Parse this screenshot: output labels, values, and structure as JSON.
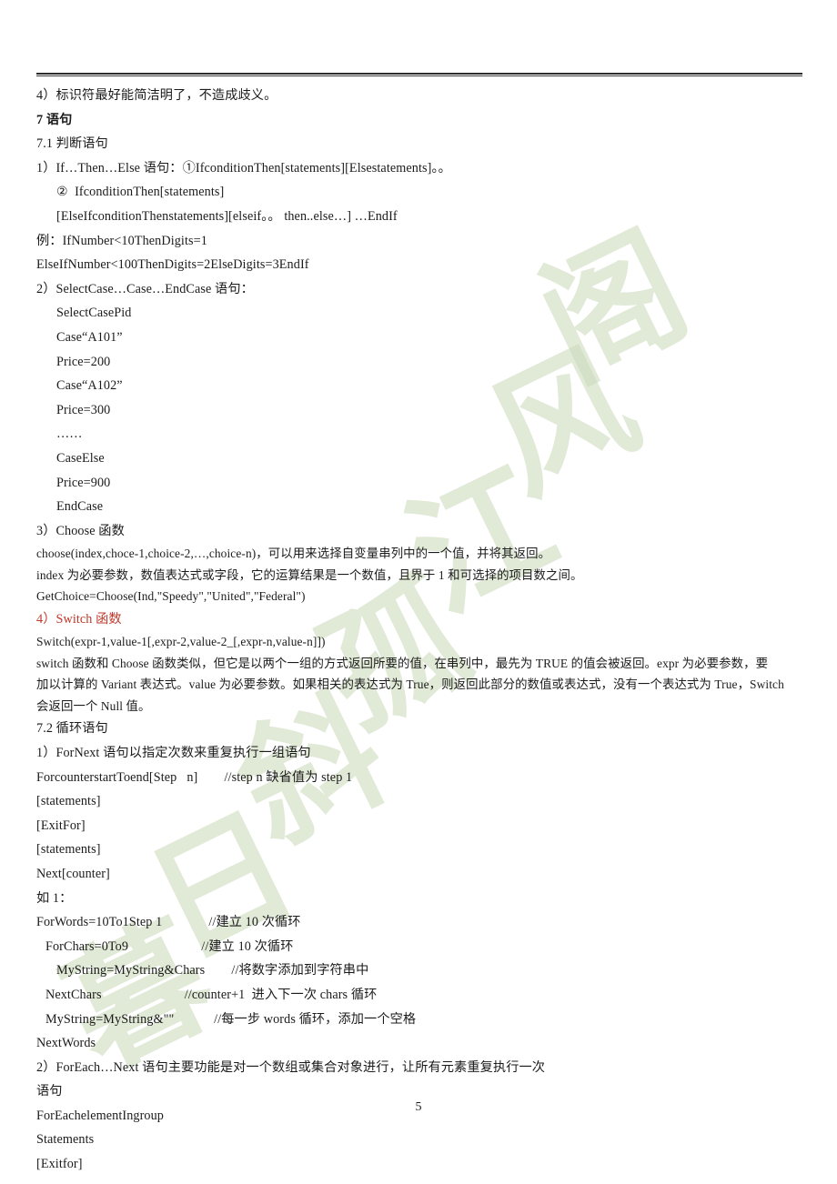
{
  "document": {
    "page_number": "5",
    "watermark_chars": [
      "阁",
      "风",
      "江",
      "孤",
      "斜",
      "日",
      "暮"
    ],
    "watermark_color": "#cfdcc0",
    "accent_red": "#c03a2b"
  },
  "body_lines": [
    {
      "text": "4）标识符最好能简洁明了，不造成歧义。",
      "indent": 0
    },
    {
      "text": "7 语句",
      "indent": 0,
      "bold": true
    },
    {
      "text": "7.1 判断语句",
      "indent": 0
    },
    {
      "text": "1）If…Then…Else 语句：①IfconditionThen[statements][Elsestatements]。。",
      "indent": 0
    },
    {
      "text": "②  IfconditionThen[statements]",
      "indent": 2
    },
    {
      "text": "[ElseIfconditionThenstatements][elseif。。 then..else…] …EndIf",
      "indent": 2
    },
    {
      "text": "例：IfNumber<10ThenDigits=1",
      "indent": 0
    },
    {
      "text": "ElseIfNumber<100ThenDigits=2ElseDigits=3EndIf",
      "indent": 0
    },
    {
      "text": "2）SelectCase…Case…EndCase 语句：",
      "indent": 0
    },
    {
      "text": "SelectCasePid",
      "indent": 2
    },
    {
      "text": "Case“A101”",
      "indent": 2
    },
    {
      "text": "Price=200",
      "indent": 2
    },
    {
      "text": "Case“A102”",
      "indent": 2
    },
    {
      "text": "Price=300",
      "indent": 2
    },
    {
      "text": "……",
      "indent": 2
    },
    {
      "text": "CaseElse",
      "indent": 2
    },
    {
      "text": "Price=900",
      "indent": 2
    },
    {
      "text": "EndCase",
      "indent": 2
    },
    {
      "text": "3）Choose 函数",
      "indent": 0
    },
    {
      "text": "choose(index,choce-1,choice-2,…,choice-n)，可以用来选择自变量串列中的一个值，并将其返回。",
      "indent": 0,
      "small": true
    },
    {
      "text": "index 为必要参数，数值表达式或字段，它的运算结果是一个数值，且界于 1 和可选择的项目数之间。",
      "indent": 0,
      "small": true
    },
    {
      "text": "GetChoice=Choose(Ind,\"Speedy\",\"United\",\"Federal\")",
      "indent": 0,
      "small": true
    },
    {
      "text": "4）Switch 函数",
      "indent": 0,
      "red": true
    },
    {
      "text": "Switch(expr-1,value-1[,expr-2,value-2_[,expr-n,value-n]])",
      "indent": 0,
      "small": true
    },
    {
      "text": "switch 函数和 Choose 函数类似，但它是以两个一组的方式返回所要的值，在串列中，最先为 TRUE 的值会被返回。expr 为必要参数，要",
      "indent": 0,
      "small": true
    },
    {
      "text": "加以计算的 Variant 表达式。value 为必要参数。如果相关的表达式为 True，则返回此部分的数值或表达式，没有一个表达式为 True，Switch",
      "indent": 0,
      "small": true
    },
    {
      "text": "会返回一个 Null 值。",
      "indent": 0,
      "small": true
    },
    {
      "text": "7.2 循环语句",
      "indent": 0
    },
    {
      "text": "1）ForNext 语句以指定次数来重复执行一组语句",
      "indent": 0
    },
    {
      "text": "ForcounterstartToend[Step   n]        //step n 缺省值为 step 1",
      "indent": 0
    },
    {
      "text": "[statements]",
      "indent": 0
    },
    {
      "text": "[ExitFor]",
      "indent": 0
    },
    {
      "text": "[statements]",
      "indent": 0
    },
    {
      "text": "Next[counter]",
      "indent": 0
    },
    {
      "text": "如 1：",
      "indent": 0
    },
    {
      "text": "ForWords=10To1Step 1              //建立 10 次循环",
      "indent": 0
    },
    {
      "text": "ForChars=0To9                      //建立 10 次循环",
      "indent": 1
    },
    {
      "text": "MyString=MyString&Chars        //将数字添加到字符串中",
      "indent": 2
    },
    {
      "text": "NextChars                         //counter+1  进入下一次 chars 循环",
      "indent": 1
    },
    {
      "text": "MyString=MyString&\"\"            //每一步 words 循环，添加一个空格",
      "indent": 1
    },
    {
      "text": "NextWords",
      "indent": 0
    },
    {
      "text": "2）ForEach…Next 语句主要功能是对一个数组或集合对象进行，让所有元素重复执行一次",
      "indent": 0
    },
    {
      "text": "语句",
      "indent": 0
    },
    {
      "text": "ForEachelementIngroup",
      "indent": 0
    },
    {
      "text": "Statements",
      "indent": 0
    },
    {
      "text": "[Exitfor]",
      "indent": 0
    }
  ]
}
